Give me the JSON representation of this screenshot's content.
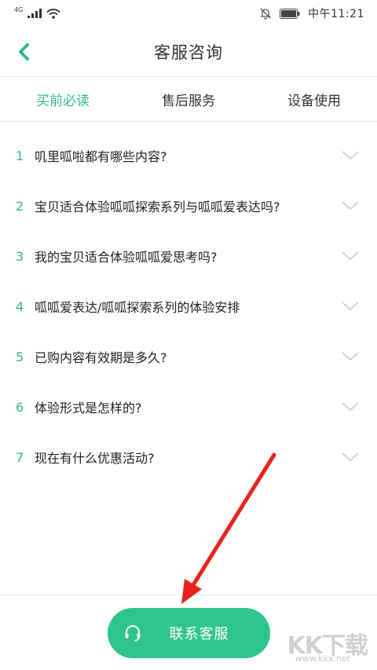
{
  "status_bar": {
    "network": "4G",
    "time": "中午11:21"
  },
  "header": {
    "title": "客服咨询"
  },
  "tabs": [
    {
      "label": "买前必读",
      "active": true
    },
    {
      "label": "售后服务",
      "active": false
    },
    {
      "label": "设备使用",
      "active": false
    }
  ],
  "faq": [
    {
      "num": "1",
      "text": "叽里呱啦都有哪些内容?"
    },
    {
      "num": "2",
      "text": "宝贝适合体验呱呱探索系列与呱呱爱表达吗?"
    },
    {
      "num": "3",
      "text": "我的宝贝适合体验呱呱爱思考吗?"
    },
    {
      "num": "4",
      "text": "呱呱爱表达/呱呱探索系列的体验安排"
    },
    {
      "num": "5",
      "text": "已购内容有效期是多久?"
    },
    {
      "num": "6",
      "text": "体验形式是怎样的?"
    },
    {
      "num": "7",
      "text": "现在有什么优惠活动?"
    }
  ],
  "contact_button": {
    "label": "联系客服"
  },
  "watermark": {
    "logo": "KK下载",
    "url": "www.kkx.net"
  },
  "colors": {
    "accent": "#2fb886",
    "button": "#2fc48d",
    "arrow": "#e8231f"
  },
  "icons": {
    "back": "chevron-left-icon",
    "expand": "chevron-down-icon",
    "headset": "headset-icon",
    "mute": "bell-off-icon",
    "battery": "battery-icon",
    "wifi": "wifi-icon"
  }
}
